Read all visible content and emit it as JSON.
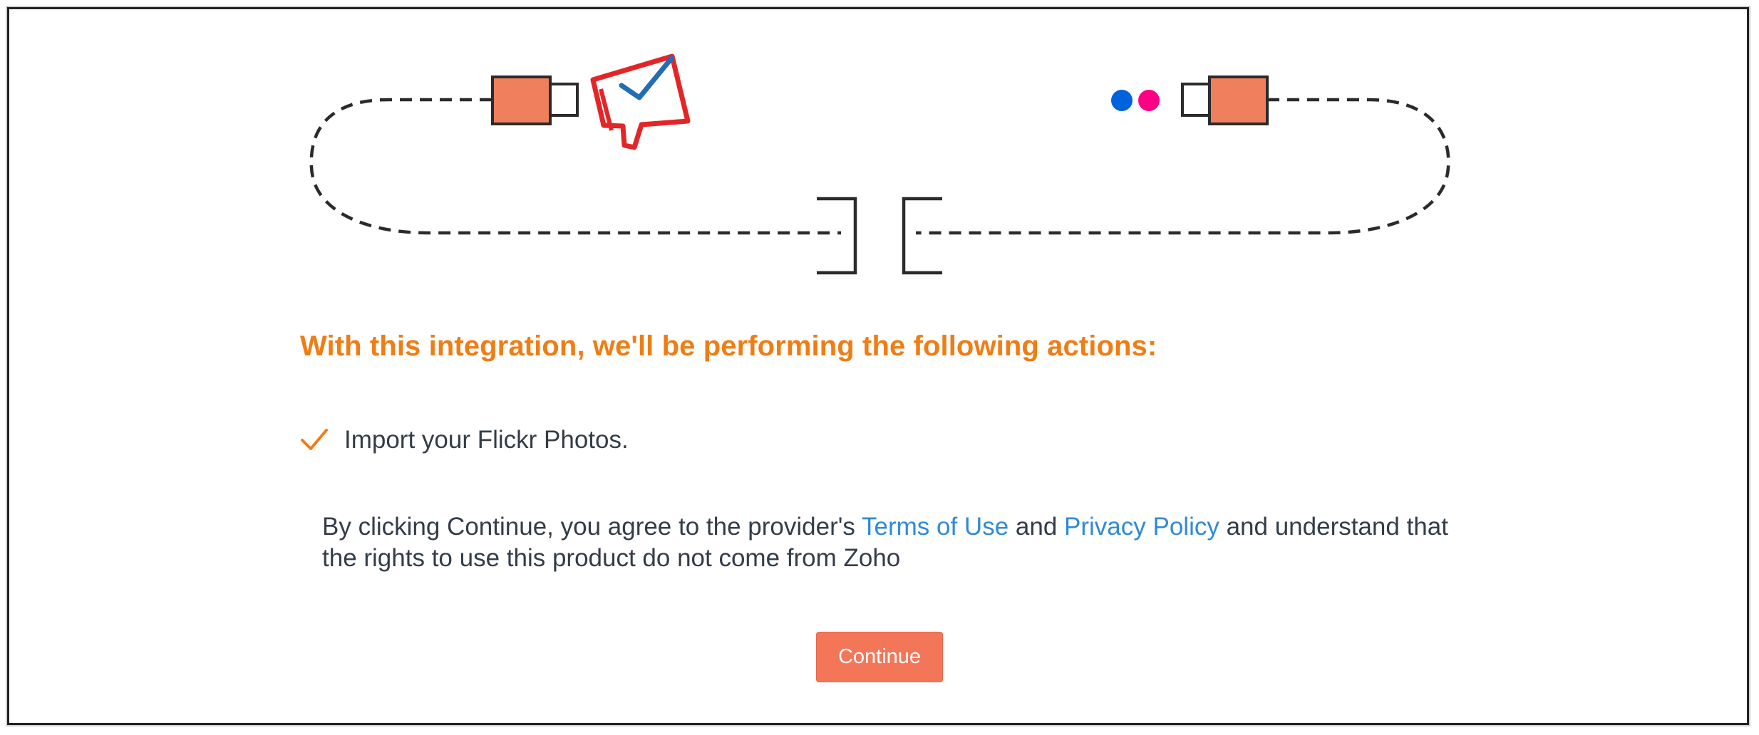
{
  "heading": "With this integration, we'll be performing the following actions:",
  "actions": [
    {
      "icon": "check-icon",
      "text": "Import your Flickr Photos."
    }
  ],
  "consent": {
    "before": "By clicking Continue, you agree to the provider's ",
    "terms_link": "Terms of Use",
    "middle": " and ",
    "privacy_link": "Privacy Policy",
    "after": " and understand that the rights to use this product do not come from Zoho"
  },
  "continue_label": "Continue",
  "icons": {
    "left_app": "zoho-app-logo-icon",
    "right_app": "flickr-logo-icon",
    "left_plug": "usb-plug-left-icon",
    "right_plug": "usb-plug-right-icon"
  },
  "colors": {
    "heading": "#f07d14",
    "link": "#2f8ad6",
    "button": "#f47659",
    "plug": "#f07f5e",
    "flickr_blue": "#0063dc",
    "flickr_pink": "#ff0084",
    "logo_red": "#e42527",
    "logo_blue": "#226db4"
  }
}
